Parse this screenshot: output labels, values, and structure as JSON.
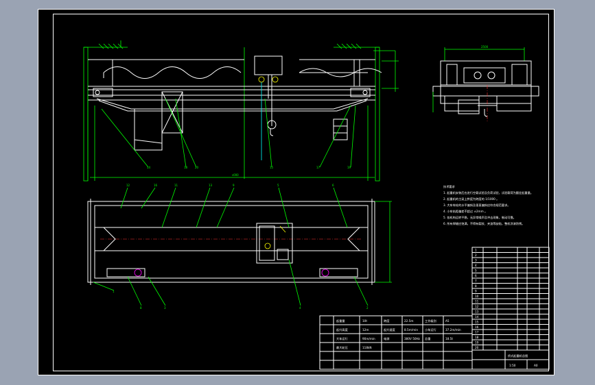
{
  "drawing": {
    "colors": {
      "background": "#9aa3b3",
      "sheet": "#000000",
      "outline": "#ffffff",
      "dimension": "#00ff00",
      "component": "#ffff00",
      "centerline": "#ff3030"
    },
    "front_view": {
      "balloons": [
        "14",
        "20",
        "18",
        "15",
        "17",
        "19"
      ],
      "span_dimension": "s000"
    },
    "plan_view": {
      "balloons_top": [
        "12",
        "16",
        "11",
        "13",
        "9",
        "5",
        "6"
      ],
      "balloons_bottom": [
        "1",
        "8",
        "3",
        "4",
        "2"
      ]
    },
    "side_view": {
      "top_dimension": "2500"
    },
    "notes": {
      "heading": "技术要求",
      "lines": [
        "1. 起重机安装后应进行空载试验及负荷试验，试验载荷为额定起重量。",
        "2. 起重机的主梁上拱度为跨度的 1/1000 。",
        "3. 大车车轮的水平偏斜及垂直偏斜应符合规范要求。",
        "4. 小车轨距偏差不超过 ±2mm 。",
        "5. 各机构运转平稳，无异常噪声及冲击现象，制动可靠。",
        "6. 所有焊缝应饱满，不得有裂纹、夹渣等缺陷，整机涂漆防锈。"
      ]
    },
    "parameter_table": {
      "cells": [
        "起重量",
        "10t",
        "跨度",
        "22.5m",
        "工作级别",
        "A5",
        "起升高度",
        "12m",
        "起升速度",
        "8.5m/min",
        "小车运行",
        "37.2m/min",
        "大车运行",
        "90m/min",
        "电源",
        "380V 50Hz",
        "总重",
        "18.5t",
        "最大轮压",
        "118kN"
      ]
    },
    "bom": {
      "rows": [
        "1",
        "2",
        "3",
        "4",
        "5",
        "6",
        "7",
        "8",
        "9",
        "10",
        "11",
        "12",
        "13",
        "14",
        "15",
        "16",
        "17",
        "18",
        "19",
        "20"
      ]
    },
    "title_block": {
      "title": "桥式起重机总图",
      "scale": "1:50",
      "sheet": "A0"
    }
  }
}
